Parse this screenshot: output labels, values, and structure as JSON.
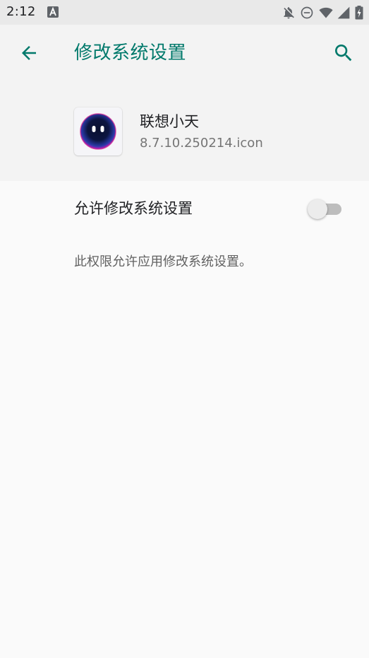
{
  "status_bar": {
    "time": "2:12",
    "icons": [
      "a-badge-icon",
      "notifications-off-icon",
      "do-not-disturb-icon",
      "wifi-icon",
      "signal-icon",
      "battery-icon"
    ]
  },
  "toolbar": {
    "title": "修改系统设置",
    "back_icon": "arrow-back-icon",
    "search_icon": "search-icon",
    "accent_color": "#00796b"
  },
  "app": {
    "name": "联想小天",
    "version": "8.7.10.250214.icon"
  },
  "permission": {
    "label": "允许修改系统设置",
    "enabled": false,
    "description": "此权限允许应用修改系统设置。"
  }
}
